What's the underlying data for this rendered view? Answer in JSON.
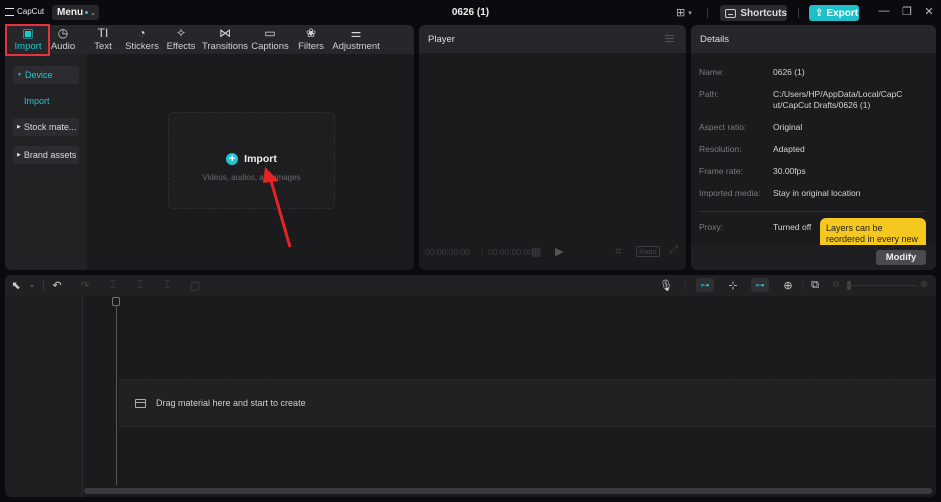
{
  "app": {
    "logo_text": "CapCut",
    "menu_label": "Menu",
    "project_title": "0626 (1)",
    "shortcuts_label": "Shortcuts",
    "export_label": "Export",
    "window_controls": [
      "minimize",
      "restore",
      "close"
    ]
  },
  "media_panel": {
    "tabs": [
      {
        "label": "Import",
        "icon": "import-icon",
        "glyph": "▣",
        "active": true
      },
      {
        "label": "Audio",
        "icon": "audio-icon",
        "glyph": "◷"
      },
      {
        "label": "Text",
        "icon": "text-icon",
        "glyph": "TI"
      },
      {
        "label": "Stickers",
        "icon": "stickers-icon",
        "glyph": "◔"
      },
      {
        "label": "Effects",
        "icon": "effects-icon",
        "glyph": "✧"
      },
      {
        "label": "Transitions",
        "icon": "transitions-icon",
        "glyph": "⋈"
      },
      {
        "label": "Captions",
        "icon": "captions-icon",
        "glyph": "▭"
      },
      {
        "label": "Filters",
        "icon": "filters-icon",
        "glyph": "❀"
      },
      {
        "label": "Adjustment",
        "icon": "adjustment-icon",
        "glyph": "⚌"
      }
    ],
    "sidebar": [
      {
        "label": "Device",
        "expanded": true,
        "selected": true
      },
      {
        "label": "Import",
        "sub": true
      },
      {
        "label": "Stock mate...",
        "expanded": false
      },
      {
        "label": "Brand assets",
        "expanded": false
      }
    ],
    "import_card": {
      "title": "Import",
      "subtitle": "Videos, audios, and images"
    }
  },
  "player": {
    "title": "Player",
    "current_time": "00:00:00:00",
    "total_time": "00:00:00:00",
    "ratio_label": "Ratio"
  },
  "details": {
    "title": "Details",
    "rows": [
      {
        "label": "Name:",
        "value": "0626 (1)"
      },
      {
        "label": "Path:",
        "value": "C:/Users/HP/AppData/Local/CapCut/CapCut Drafts/0626 (1)"
      },
      {
        "label": "Aspect ratio:",
        "value": "Original"
      },
      {
        "label": "Resolution:",
        "value": "Adapted"
      },
      {
        "label": "Frame rate:",
        "value": "30.00fps"
      },
      {
        "label": "Imported media:",
        "value": "Stay in original location"
      },
      {
        "label": "Proxy:",
        "value": "Turned off"
      }
    ],
    "tooltip": "Layers can be reordered in every new",
    "modify_label": "Modify"
  },
  "timeline": {
    "drop_hint": "Drag material here and start to create"
  },
  "colors": {
    "accent": "#1fc6d2",
    "highlight": "#e5323e",
    "tooltip": "#f5c81f"
  }
}
